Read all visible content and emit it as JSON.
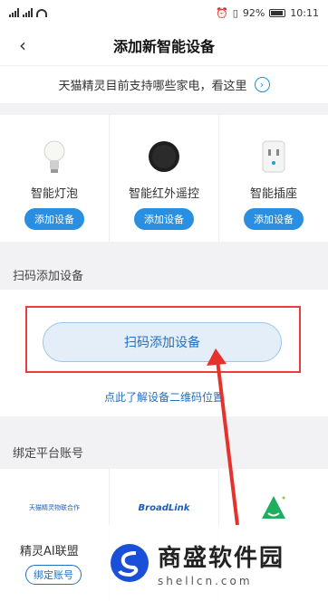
{
  "statusbar": {
    "left": "46 ⁴⁶",
    "battery": "92%",
    "time": "10:11"
  },
  "navbar": {
    "title": "添加新智能设备"
  },
  "banner": {
    "text": "天猫精灵目前支持哪些家电，看这里"
  },
  "devices": [
    {
      "name": "智能灯泡",
      "button": "添加设备",
      "icon": "bulb-icon"
    },
    {
      "name": "智能红外遥控",
      "button": "添加设备",
      "icon": "ir-remote-icon"
    },
    {
      "name": "智能插座",
      "button": "添加设备",
      "icon": "smart-plug-icon"
    }
  ],
  "scan": {
    "section_title": "扫码添加设备",
    "button": "扫码添加设备",
    "link": "点此了解设备二维码位置"
  },
  "platforms": {
    "section_title": "绑定平台账号",
    "items": [
      {
        "logo_text": "天猫精灵物联合作",
        "name": "精灵AI联盟",
        "button": "绑定账号"
      },
      {
        "logo_text": "BroadLink"
      },
      {
        "logo_text": ""
      }
    ]
  },
  "watermark": {
    "main": "商盛软件园",
    "sub": "shellcn.com"
  },
  "colors": {
    "accent": "#2a8fe0",
    "highlight": "#e53e3e"
  }
}
